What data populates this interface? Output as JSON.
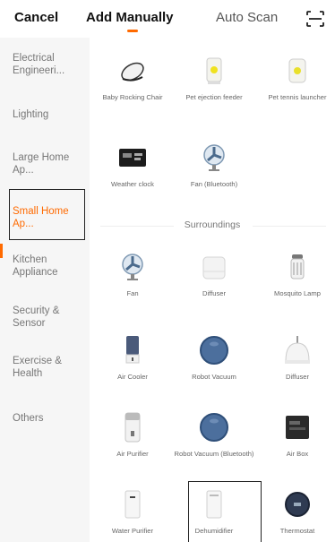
{
  "header": {
    "cancel_label": "Cancel",
    "tabs": [
      {
        "label": "Add Manually",
        "active": true
      },
      {
        "label": "Auto Scan",
        "active": false
      }
    ],
    "scan_icon": "scan-frame-icon",
    "accent_color": "#ff6a00"
  },
  "sidebar": {
    "items": [
      {
        "label": "Electrical Engineeri...",
        "selected": false
      },
      {
        "label": "Lighting",
        "selected": false
      },
      {
        "label": "Large Home Ap...",
        "selected": false
      },
      {
        "label": "Small Home Ap...",
        "selected": true
      },
      {
        "label": "Kitchen Appliance",
        "selected": false
      },
      {
        "label": "Security & Sensor",
        "selected": false
      },
      {
        "label": "Exercise & Health",
        "selected": false
      },
      {
        "label": "Others",
        "selected": false
      }
    ]
  },
  "top_devices": [
    {
      "label": "Baby Rocking Chair",
      "icon": "rocking-chair-icon"
    },
    {
      "label": "Pet ejection feeder",
      "icon": "pet-feeder-icon"
    },
    {
      "label": "Pet tennis launcher",
      "icon": "tennis-launcher-icon"
    },
    {
      "label": "Weather clock",
      "icon": "weather-clock-icon"
    },
    {
      "label": "Fan (Bluetooth)",
      "icon": "fan-icon"
    }
  ],
  "section": {
    "title": "Surroundings"
  },
  "surroundings_devices": [
    {
      "label": "Fan",
      "icon": "fan-icon"
    },
    {
      "label": "Diffuser",
      "icon": "diffuser-icon"
    },
    {
      "label": "Mosquito Lamp",
      "icon": "mosquito-lamp-icon"
    },
    {
      "label": "Air Cooler",
      "icon": "air-cooler-icon"
    },
    {
      "label": "Robot Vacuum",
      "icon": "robot-vacuum-icon"
    },
    {
      "label": "Diffuser",
      "icon": "diffuser-icon"
    },
    {
      "label": "Air Purifier",
      "icon": "air-purifier-icon"
    },
    {
      "label": "Robot Vacuum (Bluetooth)",
      "icon": "robot-vacuum-icon"
    },
    {
      "label": "Air Box",
      "icon": "air-box-icon"
    },
    {
      "label": "Water Purifier",
      "icon": "water-purifier-icon"
    },
    {
      "label": "Dehumidifier",
      "icon": "dehumidifier-icon",
      "highlighted": true
    },
    {
      "label": "Thermostat",
      "icon": "thermostat-icon"
    }
  ]
}
